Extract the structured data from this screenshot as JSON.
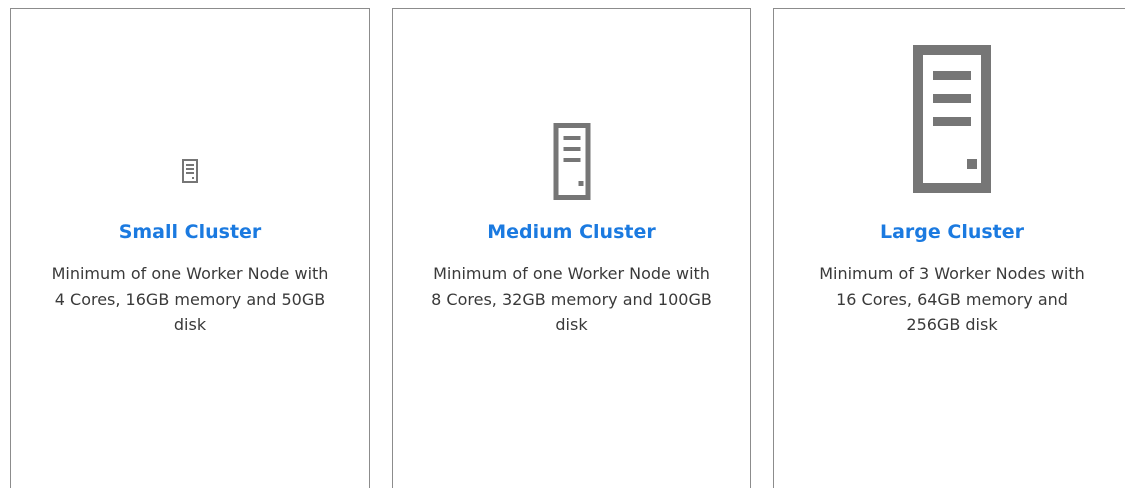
{
  "options": [
    {
      "icon": "server-tower-icon",
      "title": "Small Cluster",
      "description_lines": [
        "Minimum of one Worker Node with",
        "4 Cores, 16GB memory and 50GB",
        "disk"
      ]
    },
    {
      "icon": "server-tower-icon",
      "title": "Medium Cluster",
      "description_lines": [
        "Minimum of one Worker Node with",
        "8 Cores, 32GB memory and 100GB",
        "disk"
      ]
    },
    {
      "icon": "server-tower-icon",
      "title": "Large Cluster",
      "description_lines": [
        "Minimum of 3 Worker Nodes with",
        "16 Cores, 64GB memory and",
        "256GB disk"
      ]
    }
  ],
  "colors": {
    "title": "#1b7ae0",
    "text": "#3a3a3a",
    "icon": "#767676",
    "border": "#8c8c8c"
  }
}
